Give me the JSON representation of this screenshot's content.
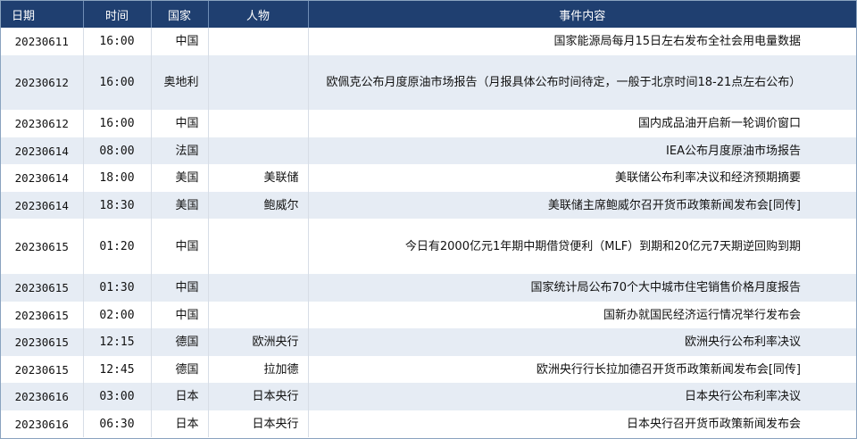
{
  "headers": {
    "date": "日期",
    "time": "时间",
    "country": "国家",
    "person": "人物",
    "event": "事件内容"
  },
  "rows": [
    {
      "date": "20230611",
      "time": "16:00",
      "country": "中国",
      "person": "",
      "event": "国家能源局每月15日左右发布全社会用电量数据"
    },
    {
      "date": "20230612",
      "time": "16:00",
      "country": "奥地利",
      "person": "",
      "event": "欧佩克公布月度原油市场报告（月报具体公布时间待定，一般于北京时间18-21点左右公布）"
    },
    {
      "date": "20230612",
      "time": "16:00",
      "country": "中国",
      "person": "",
      "event": "国内成品油开启新一轮调价窗口"
    },
    {
      "date": "20230614",
      "time": "08:00",
      "country": "法国",
      "person": "",
      "event": "IEA公布月度原油市场报告"
    },
    {
      "date": "20230614",
      "time": "18:00",
      "country": "美国",
      "person": "美联储",
      "event": "美联储公布利率决议和经济预期摘要"
    },
    {
      "date": "20230614",
      "time": "18:30",
      "country": "美国",
      "person": "鲍威尔",
      "event": "美联储主席鲍威尔召开货币政策新闻发布会[同传]"
    },
    {
      "date": "20230615",
      "time": "01:20",
      "country": "中国",
      "person": "",
      "event": "今日有2000亿元1年期中期借贷便利（MLF）到期和20亿元7天期逆回购到期"
    },
    {
      "date": "20230615",
      "time": "01:30",
      "country": "中国",
      "person": "",
      "event": "国家统计局公布70个大中城市住宅销售价格月度报告"
    },
    {
      "date": "20230615",
      "time": "02:00",
      "country": "中国",
      "person": "",
      "event": "国新办就国民经济运行情况举行发布会"
    },
    {
      "date": "20230615",
      "time": "12:15",
      "country": "德国",
      "person": "欧洲央行",
      "event": "欧洲央行公布利率决议"
    },
    {
      "date": "20230615",
      "time": "12:45",
      "country": "德国",
      "person": "拉加德",
      "event": "欧洲央行行长拉加德召开货币政策新闻发布会[同传]"
    },
    {
      "date": "20230616",
      "time": "03:00",
      "country": "日本",
      "person": "日本央行",
      "event": "日本央行公布利率决议"
    },
    {
      "date": "20230616",
      "time": "06:30",
      "country": "日本",
      "person": "日本央行",
      "event": "日本央行召开货币政策新闻发布会"
    }
  ]
}
